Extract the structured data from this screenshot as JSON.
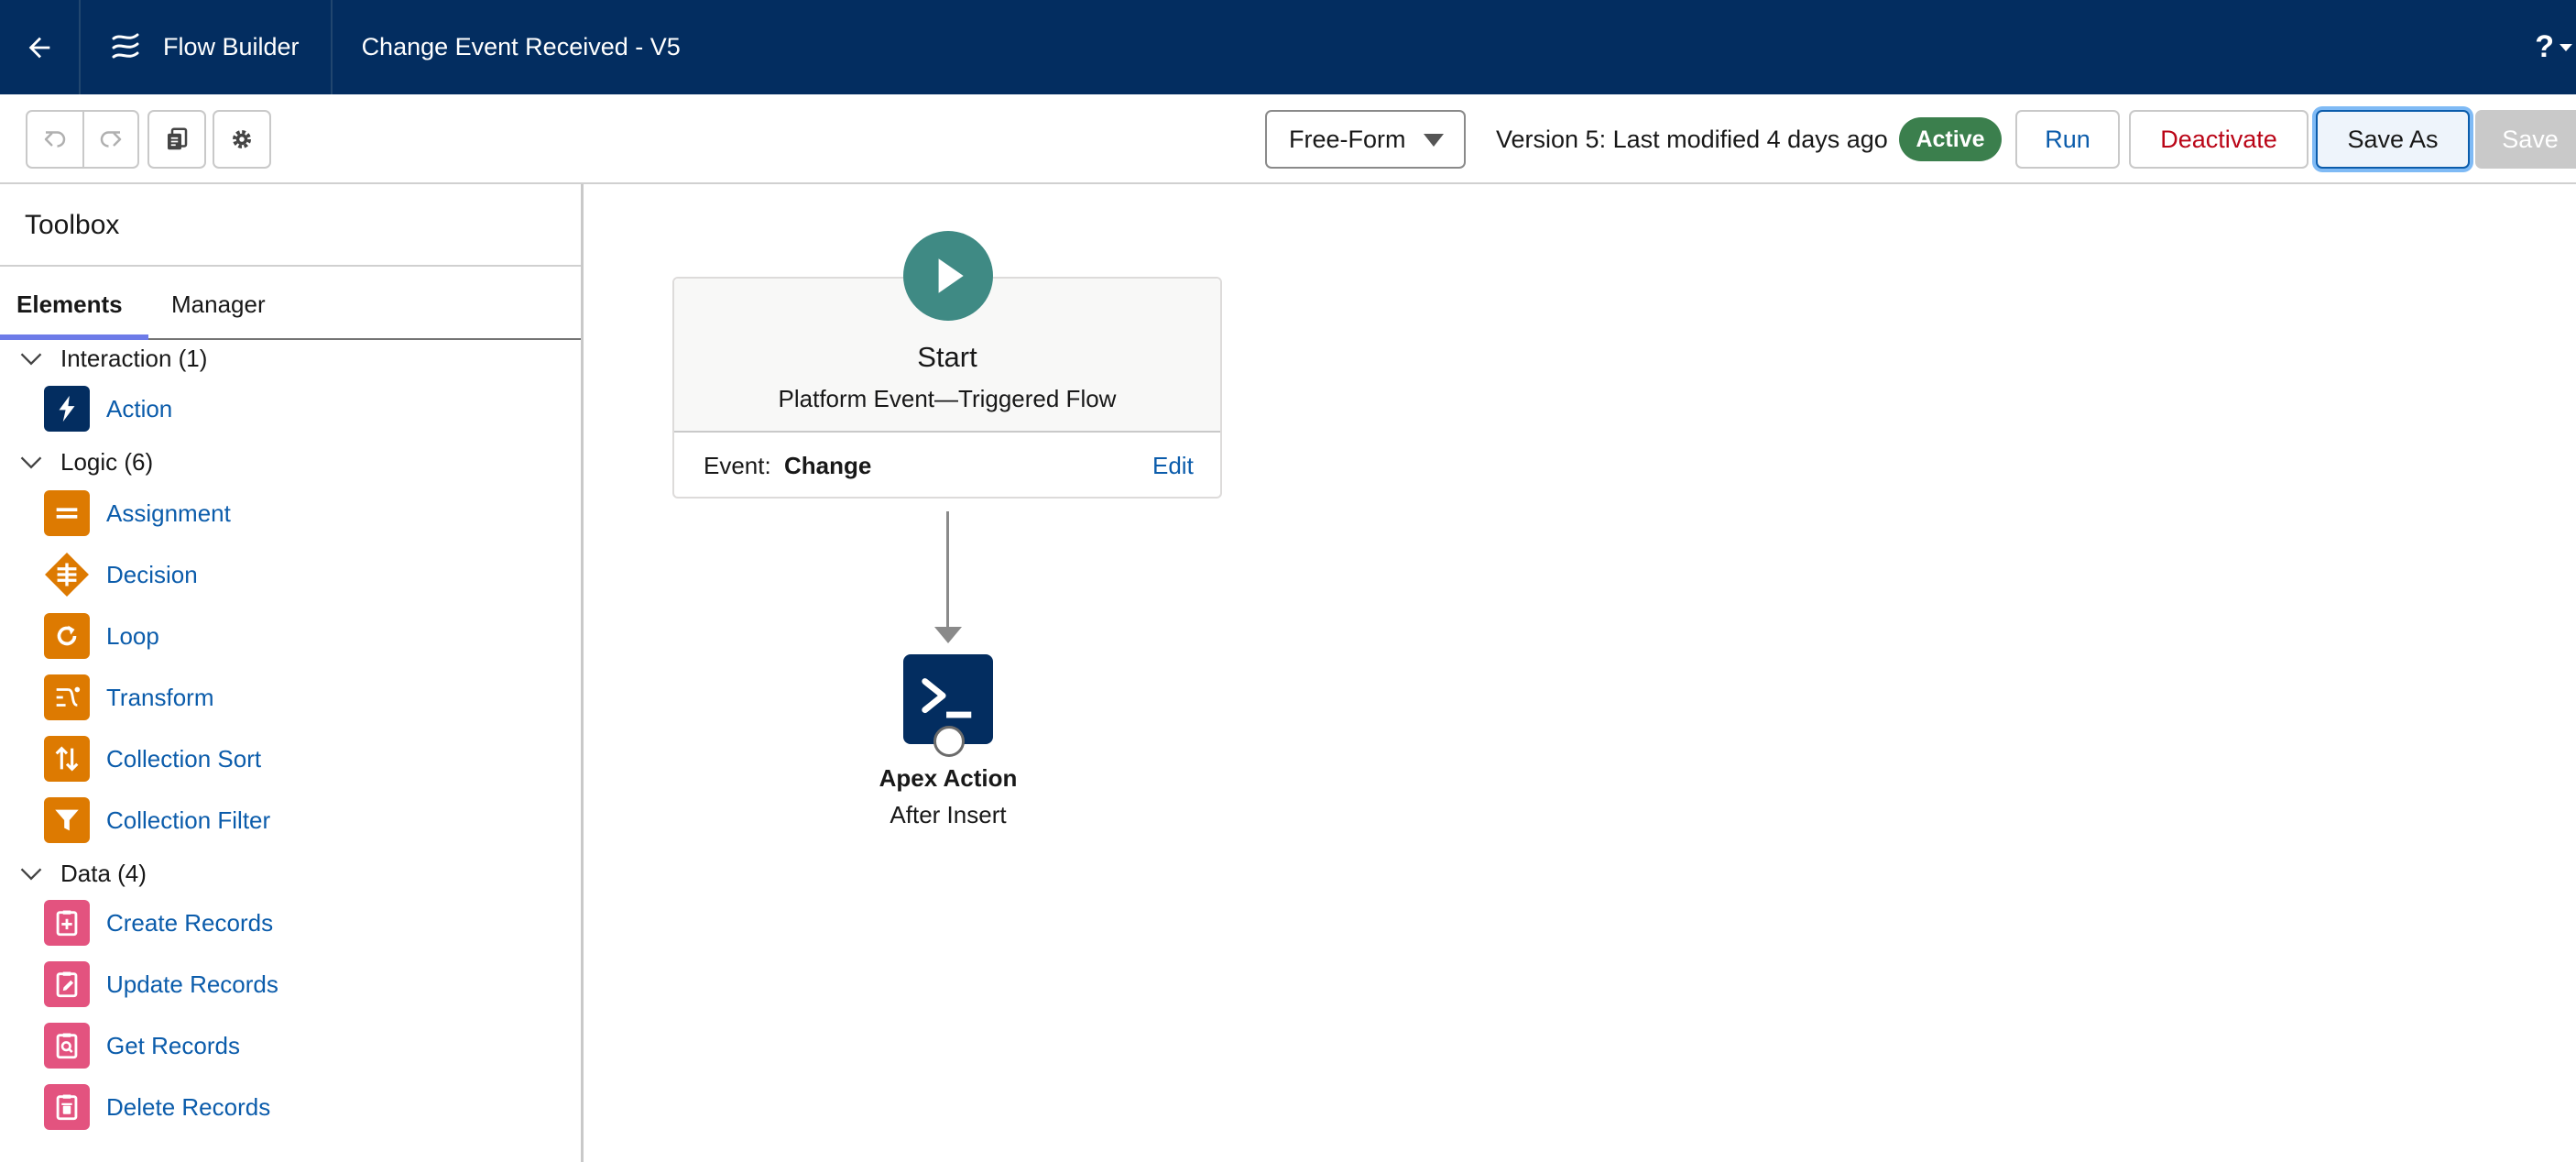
{
  "header": {
    "app_name": "Flow Builder",
    "flow_title": "Change Event Received - V5",
    "help_label": "?"
  },
  "toolbar": {
    "canvas_mode": "Free-Form",
    "version_info": "Version 5: Last modified 4 days ago",
    "status_badge": "Active",
    "run_label": "Run",
    "deactivate_label": "Deactivate",
    "save_as_label": "Save As",
    "save_label": "Save"
  },
  "sidebar": {
    "title": "Toolbox",
    "tabs": [
      {
        "label": "Elements",
        "active": true
      },
      {
        "label": "Manager",
        "active": false
      }
    ],
    "categories": [
      {
        "label": "Interaction (1)",
        "items": [
          {
            "label": "Action",
            "icon": "lightning-bolt-icon",
            "color": "#032d60"
          }
        ]
      },
      {
        "label": "Logic (6)",
        "items": [
          {
            "label": "Assignment",
            "icon": "equals-icon",
            "color": "#dd7a01"
          },
          {
            "label": "Decision",
            "icon": "decision-diamond-icon",
            "color": "#dd7a01"
          },
          {
            "label": "Loop",
            "icon": "loop-arrow-icon",
            "color": "#dd7a01"
          },
          {
            "label": "Transform",
            "icon": "transform-icon",
            "color": "#dd7a01"
          },
          {
            "label": "Collection Sort",
            "icon": "sort-arrows-icon",
            "color": "#dd7a01"
          },
          {
            "label": "Collection Filter",
            "icon": "funnel-icon",
            "color": "#dd7a01"
          }
        ]
      },
      {
        "label": "Data (4)",
        "items": [
          {
            "label": "Create Records",
            "icon": "clipboard-plus-icon",
            "color": "#e3537f"
          },
          {
            "label": "Update Records",
            "icon": "clipboard-edit-icon",
            "color": "#e3537f"
          },
          {
            "label": "Get Records",
            "icon": "clipboard-search-icon",
            "color": "#e3537f"
          },
          {
            "label": "Delete Records",
            "icon": "clipboard-trash-icon",
            "color": "#e3537f"
          }
        ]
      }
    ]
  },
  "canvas": {
    "start": {
      "label": "Start",
      "subtitle": "Platform Event—Triggered Flow",
      "event_label": "Event:",
      "event_value": "Change",
      "edit_label": "Edit"
    },
    "apex_action": {
      "label": "Apex Action",
      "subtitle": "After Insert"
    }
  },
  "colors": {
    "header_bg": "#032d60",
    "link": "#0b5cab",
    "active_badge": "#3b7f4d",
    "start_node": "#3f8a84",
    "logic_orange": "#dd7a01",
    "data_pink": "#e3537f",
    "deactivate_red": "#ba0517"
  }
}
